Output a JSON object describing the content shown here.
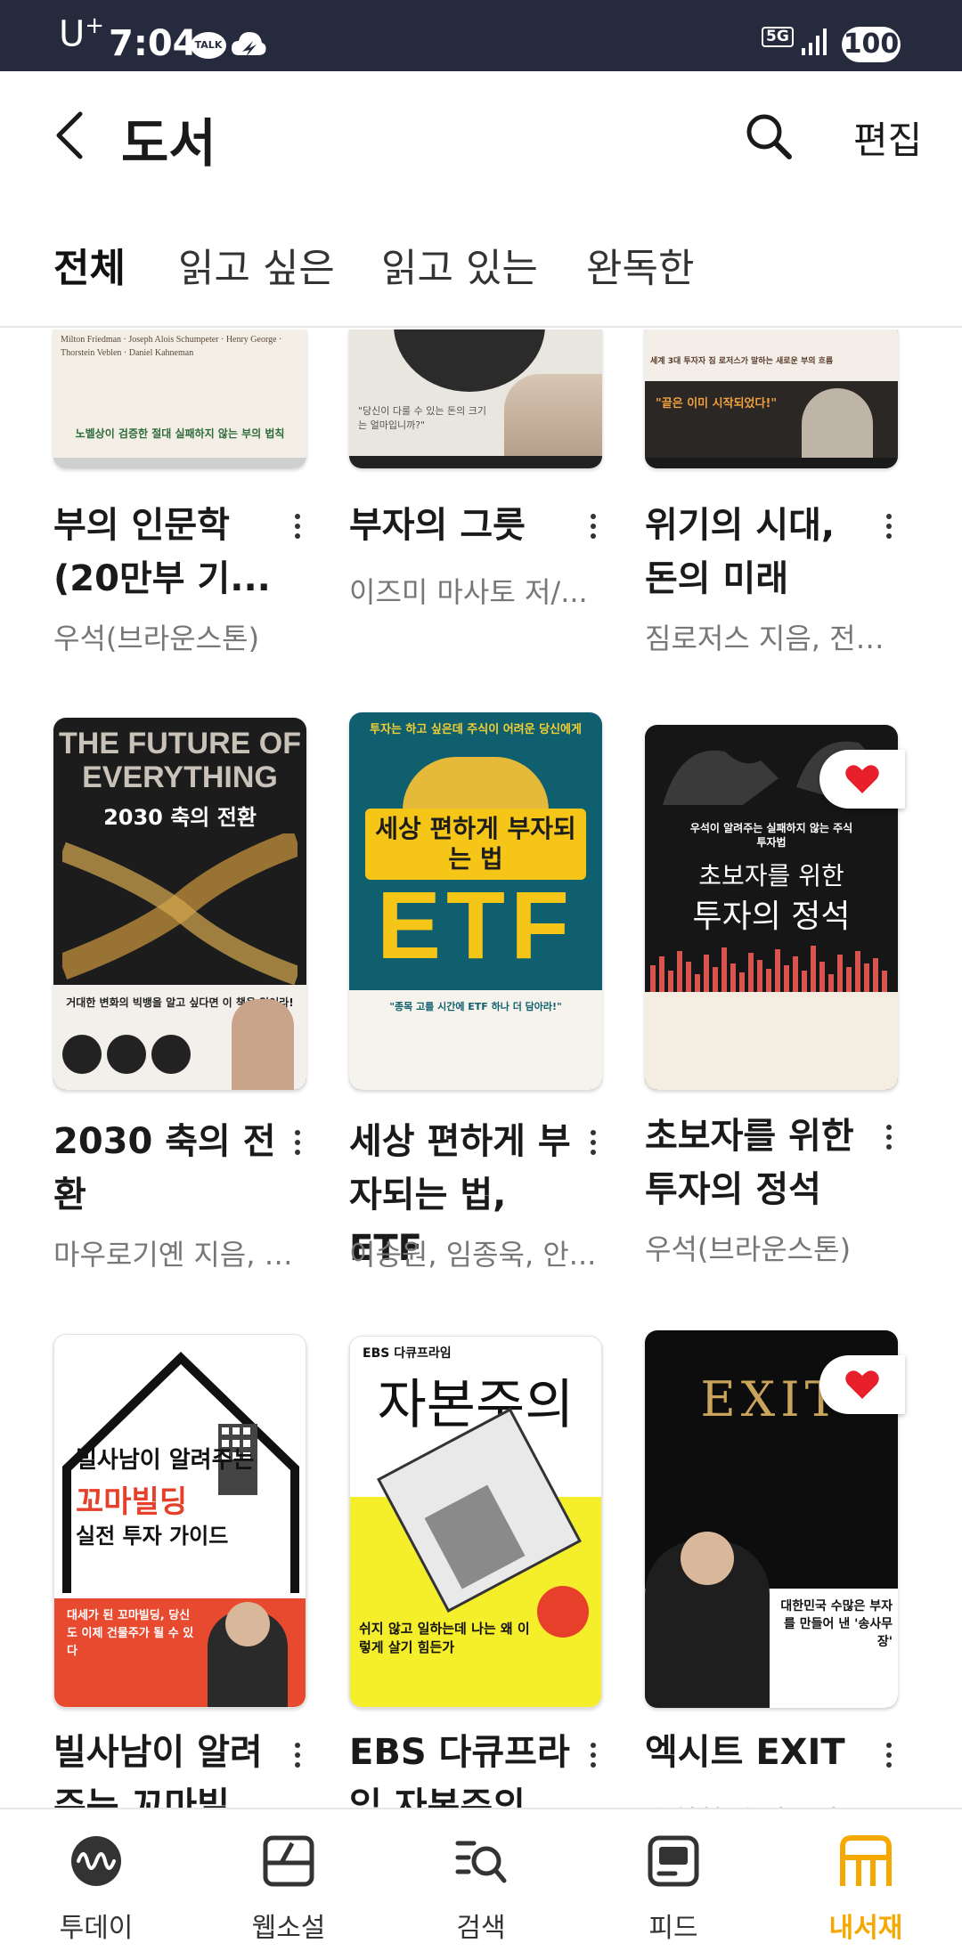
{
  "status_bar": {
    "carrier": "U",
    "carrier_sup": "+",
    "time": "7:04",
    "talk_badge": "TALK",
    "network": "5G",
    "battery": "100"
  },
  "header": {
    "title": "도서",
    "edit_label": "편집"
  },
  "tabs": [
    {
      "label": "전체",
      "active": true
    },
    {
      "label": "읽고 싶은",
      "active": false
    },
    {
      "label": "읽고 있는",
      "active": false
    },
    {
      "label": "완독한",
      "active": false
    }
  ],
  "books": [
    {
      "title": "부의 인문학 (20만부 기...",
      "author": "우석(브라운스톤)",
      "favorite": false,
      "cover_text": "노벨상이 검증한 절대 실패하지 않는 부의 법칙",
      "cover_names": "Milton Friedman · Joseph Alois Schumpeter · Henry George · Thorstein Veblen · Daniel Kahneman"
    },
    {
      "title": "부자의 그릇",
      "author": "이즈미 마사토 저/...",
      "favorite": false,
      "cover_text": "\"당신이 다룰 수 있는 돈의 크기는 얼마입니까?\""
    },
    {
      "title": "위기의 시대, 돈의 미래",
      "author": "짐로저스 지음, 전경...",
      "favorite": false,
      "cover_text": "\"끝은 이미 시작되었다!\"",
      "cover_sub": "세계 3대 투자자 짐 로저스가 말하는 새로운 부의 흐름"
    },
    {
      "title": "2030 축의 전환",
      "author": "마우로기옌 지음, 우...",
      "favorite": false,
      "cover_heading": "THE FUTURE OF EVERYTHING",
      "cover_text": "2030 축의 전환",
      "cover_sub": "거대한 변화의 빅뱅을 알고 싶다면 이 책을 읽어라!"
    },
    {
      "title": "세상 편하게 부자되는 법, ETF",
      "author": "이승원, 임종욱, 안...",
      "favorite": false,
      "cover_top": "투자는 하고 싶은데 주식이 어려운 당신에게",
      "cover_heading": "세상 편하게 부자되는 법",
      "cover_text": "ETF",
      "cover_sub": "\"종목 고를 시간에 ETF 하나 더 담아라!\""
    },
    {
      "title": "초보자를 위한 투자의 정석",
      "author": "우석(브라운스톤)",
      "favorite": true,
      "cover_top": "우석이 알려주는 실패하지 않는 주식투자법",
      "cover_heading": "초보자를 위한",
      "cover_text": "투자의 정석"
    },
    {
      "title": "빌사남이 알려주는 꼬마빌...",
      "author": "",
      "favorite": false,
      "cover_heading": "빌사남이 알려주는",
      "cover_text": "꼬마빌딩",
      "cover_sub": "실전 투자 가이드",
      "cover_bottom": "대세가 된 꼬마빌딩, 당신도 이제 건물주가 될 수 있다"
    },
    {
      "title": "EBS 다큐프라임 자본주의",
      "author": "",
      "favorite": false,
      "cover_top": "EBS 다큐프라임",
      "cover_text": "자본주의",
      "cover_sub": "쉬지 않고 일하는데 나는 왜 이렇게 살기 힘든가"
    },
    {
      "title": "엑시트 EXIT",
      "author": "송희창(송사무장)",
      "favorite": true,
      "cover_text": "EXIT",
      "cover_sub": "대한민국 수많은 부자를 만들어 낸 '송사무장'"
    }
  ],
  "bottom_nav": [
    {
      "label": "투데이",
      "icon": "today-icon",
      "active": false
    },
    {
      "label": "웹소설",
      "icon": "webnovel-icon",
      "active": false
    },
    {
      "label": "검색",
      "icon": "search-list-icon",
      "active": false
    },
    {
      "label": "피드",
      "icon": "feed-icon",
      "active": false
    },
    {
      "label": "내서재",
      "icon": "library-icon",
      "active": true
    }
  ],
  "colors": {
    "status_bar_bg": "#262a3d",
    "accent": "#f5a800",
    "heart": "#e8202b",
    "text_secondary": "#777777"
  }
}
